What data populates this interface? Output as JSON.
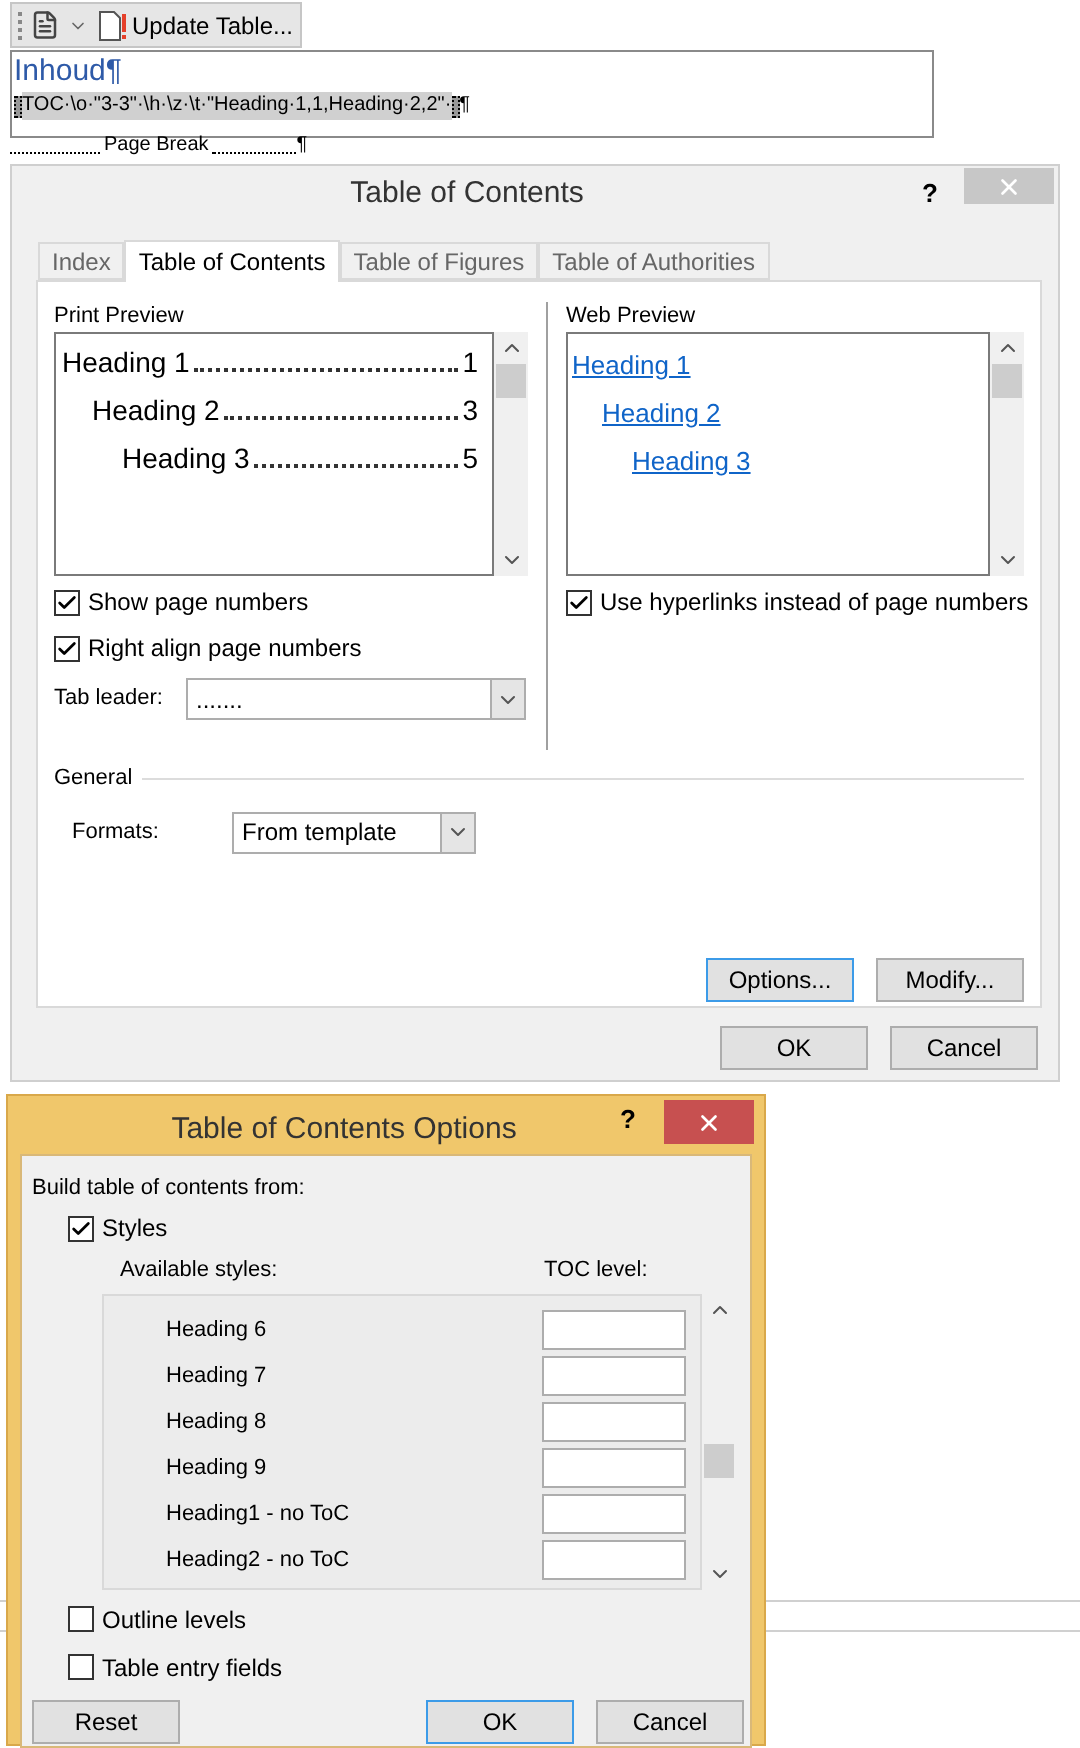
{
  "toolbar": {
    "button": "Update Table..."
  },
  "document": {
    "heading": "Inhoud¶",
    "field_code": "TOC·\\o·\"3-3\"·\\h·\\z·\\t·\"Heading·1,1,Heading·2,2\"·",
    "field_end": "¶",
    "page_break": "Page Break",
    "page_break_end": "¶"
  },
  "toc_dialog": {
    "title": "Table of Contents",
    "help": "?",
    "tabs": [
      {
        "label": "Index",
        "selected": false
      },
      {
        "label": "Table of Contents",
        "selected": true
      },
      {
        "label": "Table of Figures",
        "selected": false
      },
      {
        "label": "Table of Authorities",
        "selected": false
      }
    ],
    "print_preview": {
      "label": "Print Preview",
      "entries": [
        {
          "text": "Heading 1",
          "page": "1",
          "children": [
            {
              "text": "Heading 2",
              "page": "3",
              "children": [
                {
                  "text": "Heading 3",
                  "page": "5"
                }
              ]
            }
          ]
        }
      ]
    },
    "web_preview": {
      "label": "Web Preview",
      "links": [
        {
          "text": "Heading 1",
          "children": [
            {
              "text": "Heading 2",
              "children": [
                {
                  "text": "Heading 3"
                }
              ]
            }
          ]
        }
      ]
    },
    "checks": [
      {
        "label": "Show page numbers",
        "checked": true
      },
      {
        "label": "Right align page numbers",
        "checked": true
      }
    ],
    "tab_leader": {
      "label": "Tab leader:",
      "value": "......."
    },
    "hyperlinks": {
      "label": "Use hyperlinks instead of page numbers",
      "checked": true
    },
    "general": {
      "label": "General",
      "formats_label": "Formats:",
      "formats_value": "From template"
    },
    "buttons": [
      {
        "label": "Options...",
        "focused": true
      },
      {
        "label": "Modify...",
        "focused": false
      }
    ],
    "footer_buttons": [
      {
        "label": "OK",
        "focused": false
      },
      {
        "label": "Cancel",
        "focused": false
      }
    ]
  },
  "options_dialog": {
    "title": "Table of Contents Options",
    "help": "?",
    "build_label": "Build table of contents from:",
    "styles": {
      "label": "Styles",
      "checked": true
    },
    "columns": [
      "Available styles:",
      "TOC level:"
    ],
    "rows": [
      {
        "style": "Heading 6"
      },
      {
        "style": "Heading 7"
      },
      {
        "style": "Heading 8"
      },
      {
        "style": "Heading 9"
      },
      {
        "style": "Heading1 - no ToC"
      },
      {
        "style": "Heading2 - no ToC"
      }
    ],
    "other_checks": [
      {
        "label": "Outline levels",
        "checked": false
      },
      {
        "label": "Table entry fields",
        "checked": false
      }
    ],
    "buttons": [
      {
        "label": "Reset",
        "focused": false
      },
      {
        "label": "OK",
        "focused": true
      },
      {
        "label": "Cancel",
        "focused": false
      }
    ]
  }
}
